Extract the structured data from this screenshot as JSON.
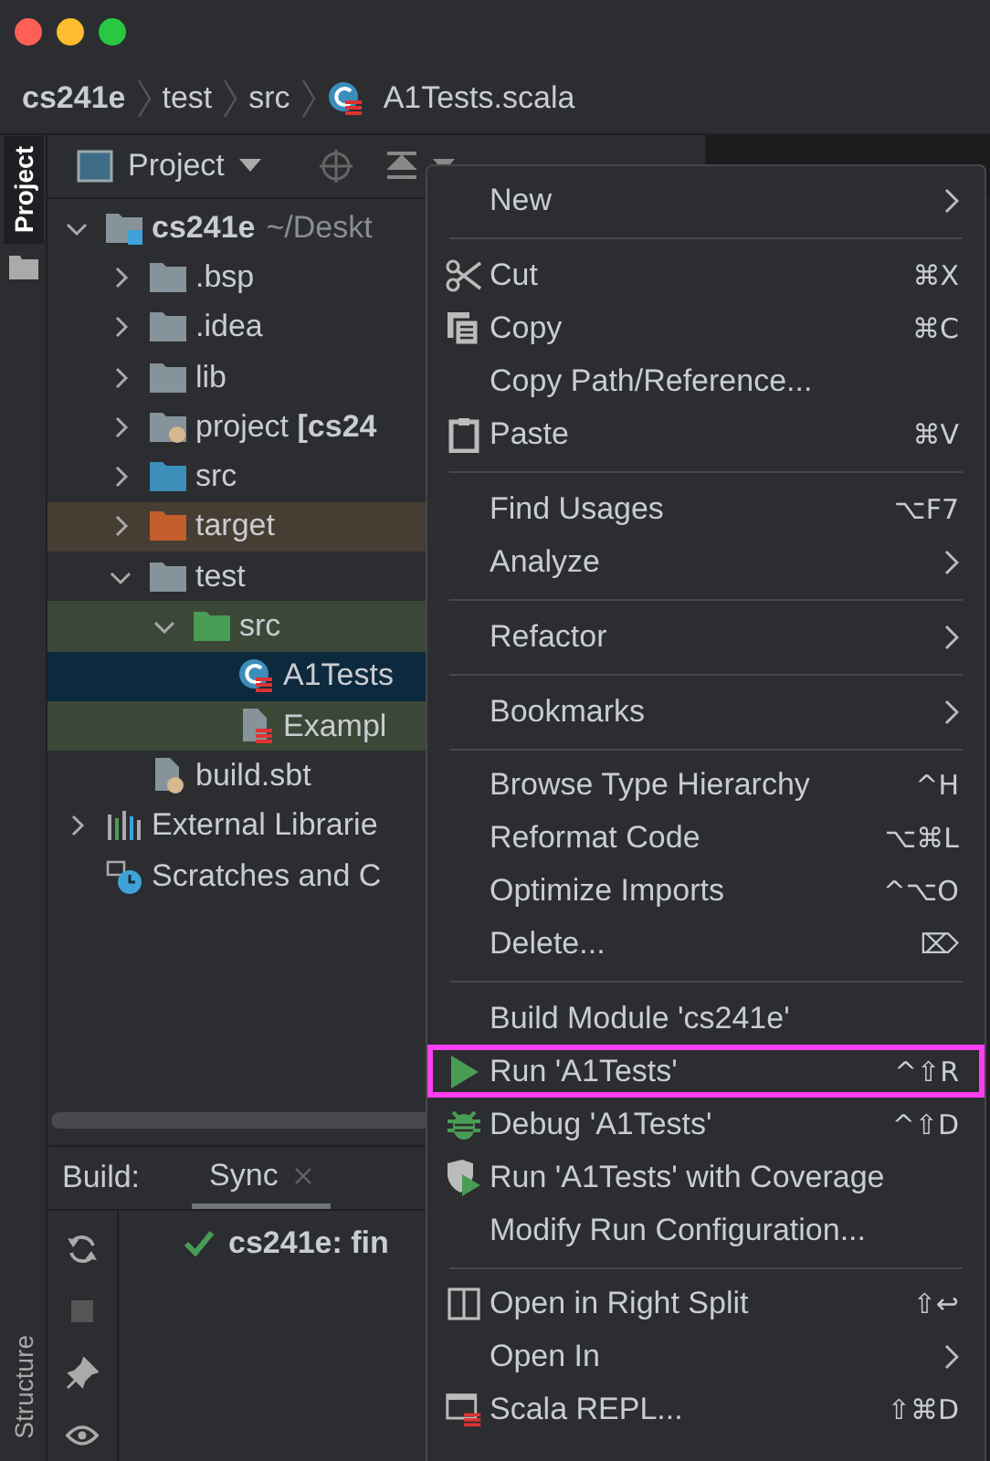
{
  "breadcrumb": [
    {
      "label": "cs241e",
      "kind": "project"
    },
    {
      "label": "test",
      "kind": "folder"
    },
    {
      "label": "src",
      "kind": "folder"
    },
    {
      "label": "A1Tests.scala",
      "kind": "scala-file"
    }
  ],
  "tool_tabs": {
    "top": [
      {
        "label": "Project",
        "selected": true
      }
    ],
    "bottom": [
      {
        "label": "Structure",
        "selected": false
      }
    ]
  },
  "project_panel": {
    "title": "Project"
  },
  "project_tree": [
    {
      "label": "cs241e",
      "suffix": "~/Deskt",
      "kind": "module",
      "expanded": true,
      "selected": false,
      "in_test": false,
      "children": [
        {
          "label": ".bsp",
          "kind": "folder",
          "expanded": false,
          "selected": false,
          "in_test": false
        },
        {
          "label": ".idea",
          "kind": "folder",
          "expanded": false,
          "selected": false,
          "in_test": false
        },
        {
          "label": "lib",
          "kind": "folder",
          "expanded": false,
          "selected": false,
          "in_test": false
        },
        {
          "label": "project **[cs24**",
          "kind": "sbt-folder",
          "expanded": false,
          "selected": false,
          "in_test": false
        },
        {
          "label": "src",
          "kind": "source-folder",
          "expanded": false,
          "selected": false,
          "in_test": false
        },
        {
          "label": "target",
          "kind": "excluded-folder",
          "expanded": false,
          "selected": false,
          "in_test": false
        },
        {
          "label": "test",
          "kind": "folder",
          "expanded": true,
          "selected": false,
          "in_test": false,
          "children": [
            {
              "label": "src",
              "kind": "test-folder",
              "expanded": true,
              "selected": false,
              "in_test": true,
              "children": [
                {
                  "label": "A1Tests",
                  "kind": "scala-object",
                  "selected": true,
                  "in_test": true
                },
                {
                  "label": "Exampl",
                  "kind": "scala-file",
                  "selected": false,
                  "in_test": true
                }
              ]
            }
          ]
        },
        {
          "label": "build.sbt",
          "kind": "sbt-file",
          "selected": false,
          "in_test": false
        }
      ]
    },
    {
      "label": "External Librarie",
      "kind": "libraries",
      "expanded": false,
      "selected": false,
      "in_test": false
    },
    {
      "label": "Scratches and C",
      "kind": "scratches",
      "selected": false,
      "in_test": false
    }
  ],
  "build_panel": {
    "label": "Build:",
    "tabs": [
      {
        "label": "Sync",
        "selected": true,
        "closable": true
      }
    ],
    "rows": [
      {
        "kind": "success",
        "text": "cs241e: fin"
      }
    ]
  },
  "context_menu": {
    "groups": [
      [
        {
          "label": "New",
          "submenu": true,
          "highlighted": false
        }
      ],
      [
        {
          "label": "Cut",
          "kind": "cut",
          "shortcut": "⌘X",
          "submenu": false,
          "highlighted": false
        },
        {
          "label": "Copy",
          "kind": "copy",
          "shortcut": "⌘C",
          "submenu": false,
          "highlighted": false
        },
        {
          "label": "Copy Path/Reference...",
          "submenu": false,
          "highlighted": false
        },
        {
          "label": "Paste",
          "kind": "paste",
          "shortcut": "⌘V",
          "submenu": false,
          "highlighted": false
        }
      ],
      [
        {
          "label": "Find Usages",
          "shortcut": "⌥F7",
          "submenu": false,
          "highlighted": false
        },
        {
          "label": "Analyze",
          "submenu": true,
          "highlighted": false
        }
      ],
      [
        {
          "label": "Refactor",
          "submenu": true,
          "highlighted": false
        }
      ],
      [
        {
          "label": "Bookmarks",
          "submenu": true,
          "highlighted": false
        }
      ],
      [
        {
          "label": "Browse Type Hierarchy",
          "shortcut": "^H",
          "submenu": false,
          "highlighted": false
        },
        {
          "label": "Reformat Code",
          "shortcut": "⌥⌘L",
          "submenu": false,
          "highlighted": false
        },
        {
          "label": "Optimize Imports",
          "shortcut": "^⌥O",
          "submenu": false,
          "highlighted": false
        },
        {
          "label": "Delete...",
          "shortcut": "⌦",
          "submenu": false,
          "highlighted": false
        }
      ],
      [
        {
          "label": "Build Module 'cs241e'",
          "submenu": false,
          "highlighted": false
        },
        {
          "label": "Run 'A1Tests'",
          "kind": "run",
          "shortcut": "^⇧R",
          "submenu": false,
          "highlighted": true
        },
        {
          "label": "Debug 'A1Tests'",
          "kind": "debug",
          "shortcut": "^⇧D",
          "submenu": false,
          "highlighted": false
        },
        {
          "label": "Run 'A1Tests' with Coverage",
          "kind": "coverage",
          "submenu": false,
          "highlighted": false
        },
        {
          "label": "Modify Run Configuration...",
          "submenu": false,
          "highlighted": false
        }
      ],
      [
        {
          "label": "Open in Right Split",
          "kind": "split",
          "shortcut": "⇧↩",
          "submenu": false,
          "highlighted": false
        },
        {
          "label": "Open In",
          "submenu": true,
          "highlighted": false
        },
        {
          "label": "Scala REPL...",
          "kind": "repl",
          "shortcut": "⇧⌘D",
          "submenu": false,
          "highlighted": false
        }
      ]
    ]
  }
}
